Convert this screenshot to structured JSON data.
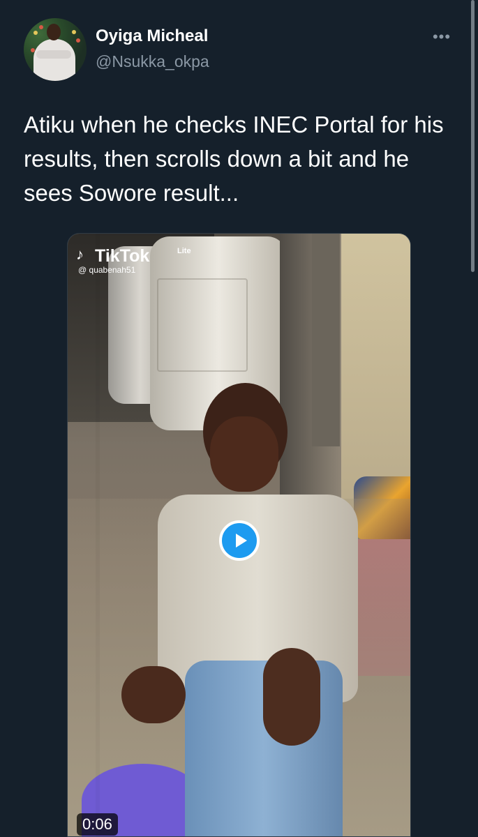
{
  "tweet": {
    "author": {
      "display_name": "Oyiga Micheal",
      "handle": "@Nsukka_okpa"
    },
    "text": "Atiku when he checks INEC Portal for his results, then scrolls down a bit and he sees Sowore result...",
    "more_icon": "ellipsis-icon",
    "media": {
      "brand": "TikTok",
      "brand_suffix": "Lite",
      "creator": "@ quabenah51",
      "duration": "0:06",
      "play_icon": "play-icon"
    }
  },
  "colors": {
    "background": "#15202b",
    "primary_text": "#ffffff",
    "secondary_text": "#8b98a5",
    "accent": "#1d9bf0"
  }
}
